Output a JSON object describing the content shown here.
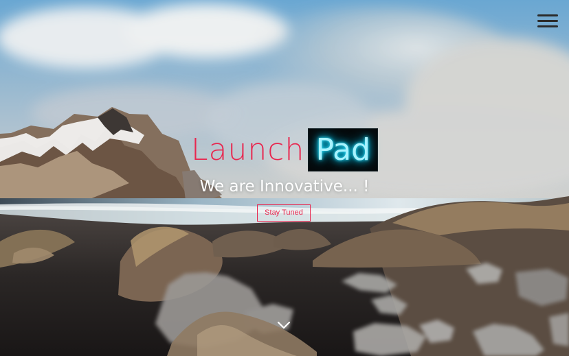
{
  "hero": {
    "brand": {
      "launch": "Launch",
      "pad": "Pad"
    },
    "tagline": "We are Innovative... !",
    "cta_label": "Stay Tuned"
  },
  "icons": {
    "menu": "hamburger-menu-icon",
    "scroll": "chevron-down-icon"
  },
  "colors": {
    "accent": "#e8274f",
    "neon": "#00d8ff",
    "pad_background": "#05090b",
    "menu_icon": "#2b2b2b"
  }
}
